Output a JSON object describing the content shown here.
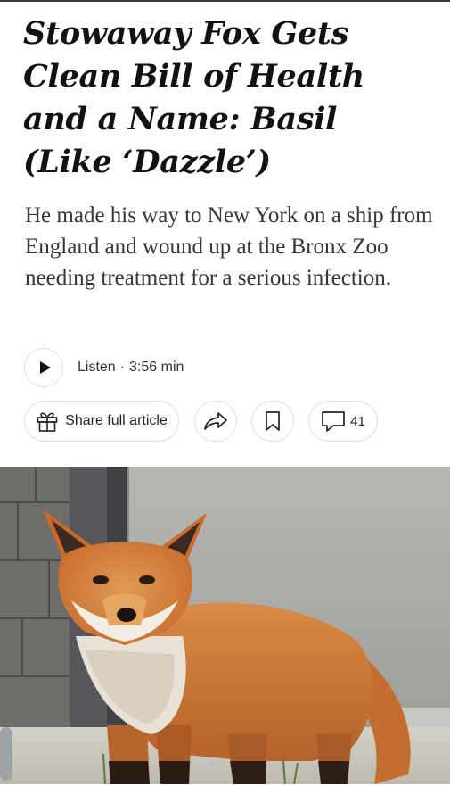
{
  "article": {
    "headline": "Stowaway Fox Gets Clean Bill of Health and a Name: Basil (Like ‘Dazzle’)",
    "summary": "He made his way to New York on a ship from England and wound up at the Bronx Zoo needing treatment for a serious infection."
  },
  "listen": {
    "label": "Listen",
    "separator": "·",
    "duration": "3:56 min"
  },
  "actions": {
    "share_full_label": "Share full article",
    "comment_count": "41"
  },
  "icons": {
    "play": "play-icon",
    "gift": "gift-icon",
    "share": "share-arrow-icon",
    "bookmark": "bookmark-icon",
    "comment": "comment-icon"
  },
  "colors": {
    "text": "#121212",
    "summary_text": "#363636",
    "border": "#dfdfdf",
    "fox_fur": "#d7742a"
  }
}
